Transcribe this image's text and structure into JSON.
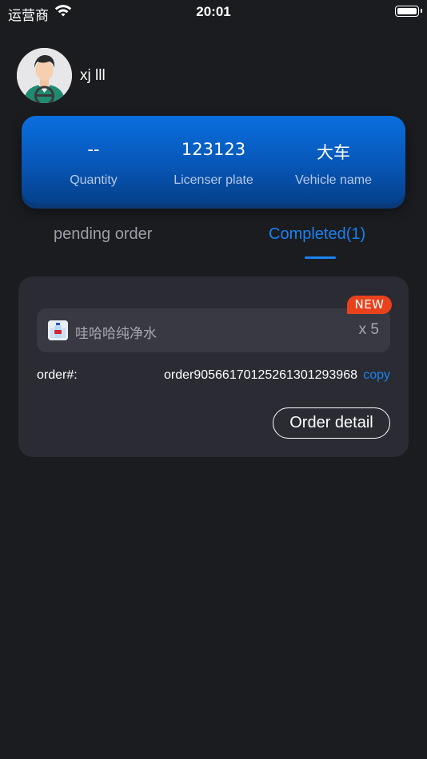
{
  "status_bar": {
    "carrier": "运营商",
    "time": "20:01",
    "wifi_icon": "wifi-icon",
    "battery_icon": "battery-icon",
    "battery_level": 1.0
  },
  "profile": {
    "avatar_icon": "driver-avatar",
    "name": "xj lll"
  },
  "stats": [
    {
      "value": "--",
      "label": "Quantity"
    },
    {
      "value": "123123",
      "label": "Licenser plate"
    },
    {
      "value": "大车",
      "label": "Vehicle name"
    }
  ],
  "tabs": {
    "pending": "pending order",
    "completed": "Completed(1)",
    "active": "completed"
  },
  "order": {
    "badge": "NEW",
    "product_icon": "water-bottle-icon",
    "product_name": "哇哈哈纯净水",
    "quantity": "x 5",
    "order_label": "order#:",
    "order_number": "order905661701252613012939​68",
    "copy_label": "copy",
    "detail_label": "Order detail"
  },
  "colors": {
    "background": "#1b1c20",
    "card": "#2a2b33",
    "accent": "#1a82f0",
    "badge": "#e8421d",
    "stats_card": "#0757b8"
  }
}
